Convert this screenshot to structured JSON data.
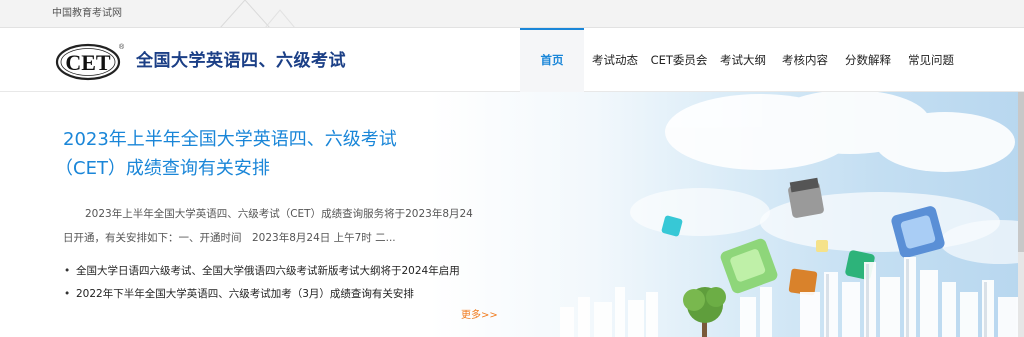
{
  "topbar": {
    "link": "中国教育考试网"
  },
  "header": {
    "logo_text": "CET",
    "logo_mark": "®",
    "title": "全国大学英语四、六级考试"
  },
  "nav": [
    {
      "label": "首页",
      "active": true
    },
    {
      "label": "考试动态",
      "active": false
    },
    {
      "label": "CET委员会",
      "active": false
    },
    {
      "label": "考试大纲",
      "active": false
    },
    {
      "label": "考核内容",
      "active": false
    },
    {
      "label": "分数解释",
      "active": false
    },
    {
      "label": "常见问题",
      "active": false
    }
  ],
  "banner": {
    "headline_line1": "2023年上半年全国大学英语四、六级考试",
    "headline_line2": "（CET）成绩查询有关安排",
    "summary": "2023年上半年全国大学英语四、六级考试（CET）成绩查询服务将于2023年8月24日开通，有关安排如下：一、开通时间　2023年8月24日 上午7时 二...",
    "news": [
      {
        "bullet": "•",
        "text": "全国大学日语四六级考试、全国大学俄语四六级考试新版考试大纲将于2024年启用"
      },
      {
        "bullet": "•",
        "text": "2022年下半年全国大学英语四、六级考试加考（3月）成绩查询有关安排"
      }
    ],
    "more": "更多>>"
  },
  "colors": {
    "accent": "#1a86d8",
    "title_blue": "#1b3f86",
    "more_orange": "#f07b1e"
  }
}
